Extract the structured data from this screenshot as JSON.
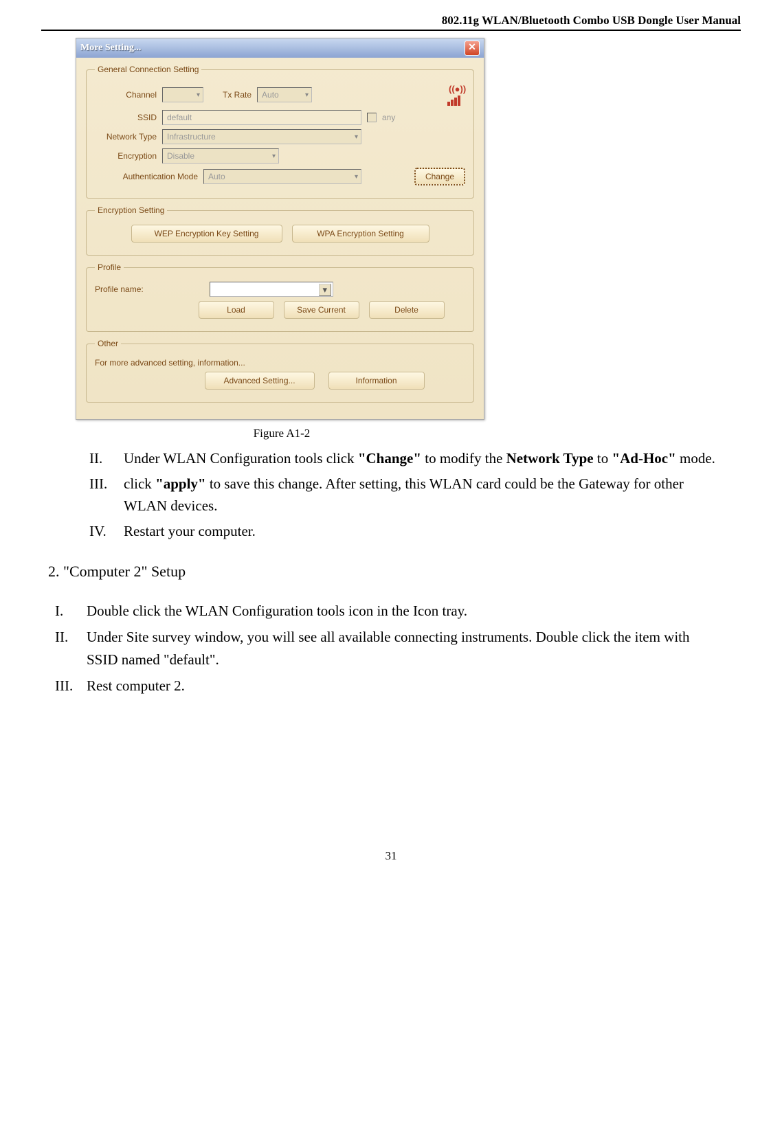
{
  "header": "802.11g  WLAN/Bluetooth  Combo  USB  Dongle  User  Manual",
  "dialog": {
    "title": "More Setting...",
    "group_general": "General Connection Setting",
    "channel_label": "Channel",
    "channel_val": "",
    "txrate_label": "Tx Rate",
    "txrate_val": "Auto",
    "ssid_label": "SSID",
    "ssid_val": "default",
    "any_label": "any",
    "nettype_label": "Network Type",
    "nettype_val": "Infrastructure",
    "enc_label": "Encryption",
    "enc_val": "Disable",
    "auth_label": "Authentication Mode",
    "auth_val": "Auto",
    "change_btn": "Change",
    "group_enc": "Encryption Setting",
    "wep_btn": "WEP Encryption Key Setting",
    "wpa_btn": "WPA Encryption Setting",
    "group_profile": "Profile",
    "profile_name_label": "Profile name:",
    "load_btn": "Load",
    "savecur_btn": "Save Current",
    "delete_btn": "Delete",
    "group_other": "Other",
    "other_text": "For more advanced setting, information...",
    "adv_btn": "Advanced Setting...",
    "info_btn": "Information"
  },
  "figure_caption": "Figure A1-2",
  "list1": {
    "ii_a": "Under WLAN Configuration tools click ",
    "ii_b": "\"Change\"",
    "ii_c": " to modify the ",
    "ii_d": "Network Type",
    "ii_e": " to ",
    "ii_f": "\"Ad-Hoc\"",
    "ii_g": " mode.",
    "iii_a": "click ",
    "iii_b": "\"apply\"",
    "iii_c": " to save this change. After setting, this WLAN card could be the Gateway for other WLAN devices.",
    "iv": "Restart your computer."
  },
  "section2": "2. \"Computer 2\" Setup",
  "list2": {
    "i": "Double click the WLAN Configuration tools icon in the Icon tray.",
    "ii": "Under Site survey window, you will see all available connecting instruments. Double click the item   with SSID named \"default\".",
    "iii": "Rest computer 2."
  },
  "page_num": "31"
}
